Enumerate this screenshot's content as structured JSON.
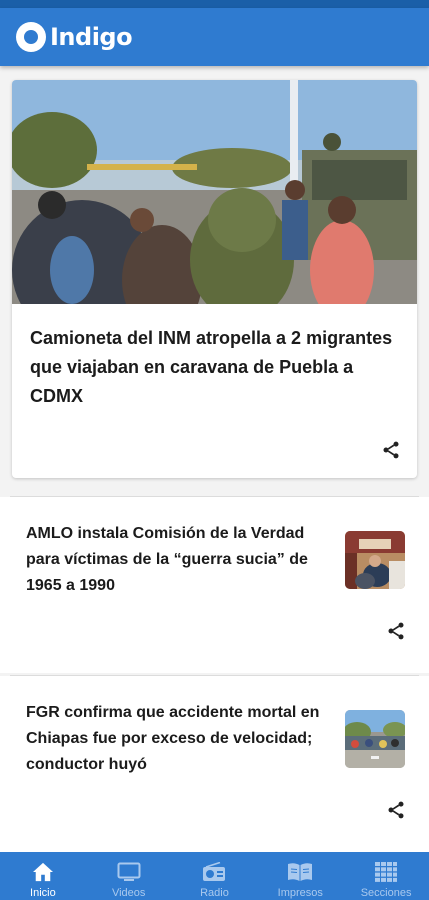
{
  "app": {
    "logo_text": "Indigo",
    "colors": {
      "primary": "#2f7bd0",
      "primary_dark": "#1a5fa8",
      "nav_inactive": "#a9c9ee"
    }
  },
  "feature": {
    "title": "Camioneta del INM atropella a 2 migrantes que viajaban en caravana de Puebla a CDMX",
    "image": "photo-migrant-caravan-military-truck",
    "share_icon": "share-icon"
  },
  "articles": [
    {
      "title": "AMLO instala Comisión de la Verdad para víctimas de la “guerra sucia” de 1965 a 1990",
      "thumbnail": "photo-commission-ceremony",
      "share_icon": "share-icon"
    },
    {
      "title": "FGR confirma que accidente mortal en Chiapas fue por exceso de velocidad; conductor huyó",
      "thumbnail": "photo-highway-crowd",
      "share_icon": "share-icon"
    }
  ],
  "bottom_nav": [
    {
      "label": "Inicio",
      "icon": "home-icon",
      "active": true
    },
    {
      "label": "Videos",
      "icon": "tv-icon",
      "active": false
    },
    {
      "label": "Radio",
      "icon": "radio-icon",
      "active": false
    },
    {
      "label": "Impresos",
      "icon": "open-book-icon",
      "active": false
    },
    {
      "label": "Secciones",
      "icon": "grid-icon",
      "active": false
    }
  ]
}
